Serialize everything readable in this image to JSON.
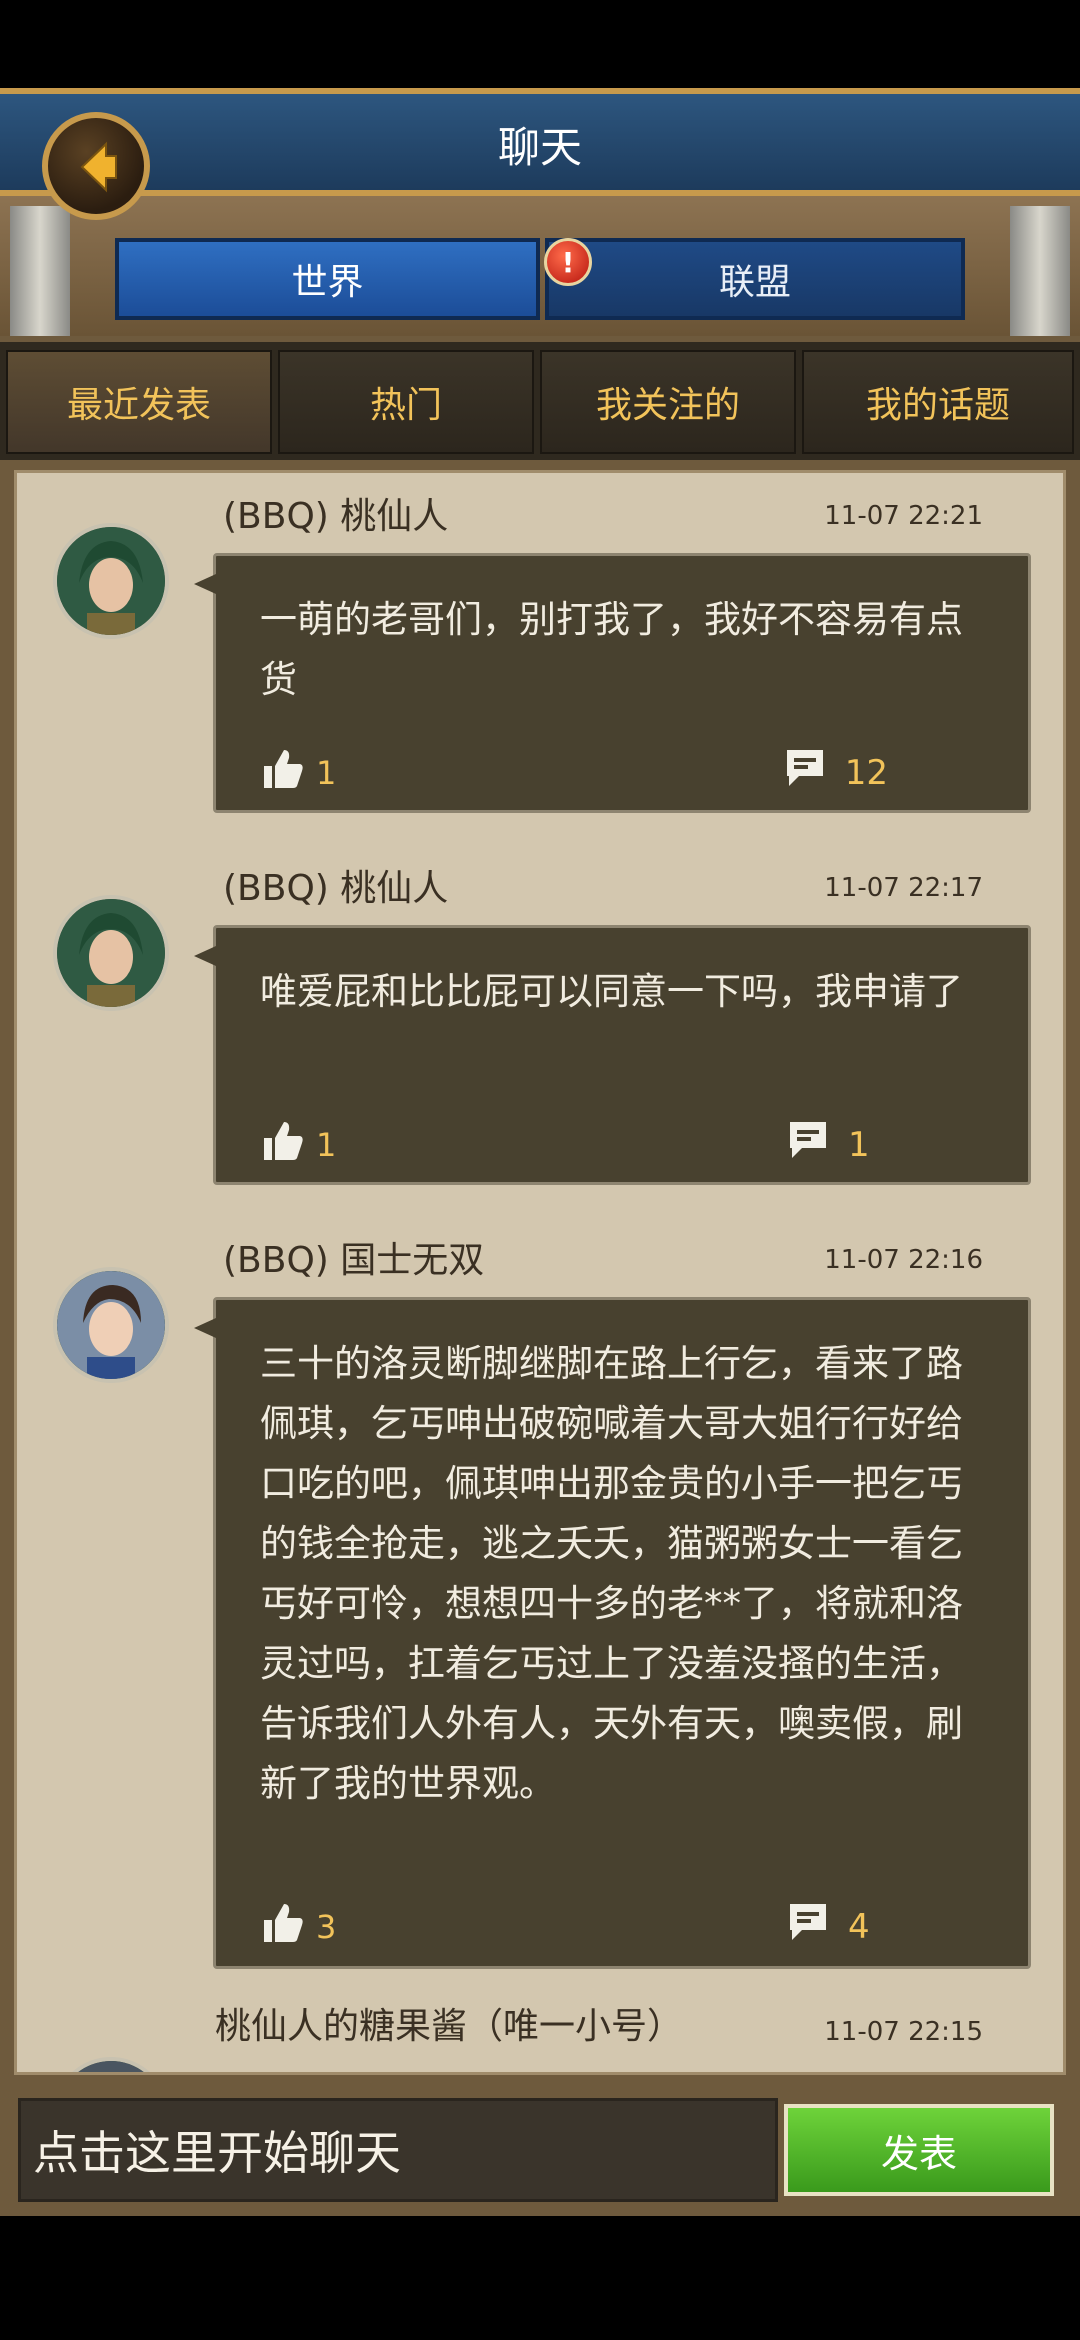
{
  "header": {
    "title": "聊天"
  },
  "channels": [
    {
      "label": "世界",
      "active": true
    },
    {
      "label": "联盟",
      "active": false
    }
  ],
  "channel_badge": "!",
  "subtabs": [
    {
      "label": "最近发表",
      "active": true
    },
    {
      "label": "热门",
      "active": false
    },
    {
      "label": "我关注的",
      "active": false
    },
    {
      "label": "我的话题",
      "active": false
    }
  ],
  "posts": [
    {
      "author": "(BBQ) 桃仙人",
      "time": "11-07 22:21",
      "text": "一萌的老哥们，别打我了，我好不容易有点货",
      "likes": "1",
      "comments": "12"
    },
    {
      "author": "(BBQ) 桃仙人",
      "time": "11-07 22:17",
      "text": "唯爱屁和比比屁可以同意一下吗，我申请了",
      "likes": "1",
      "comments": "1"
    },
    {
      "author": "(BBQ) 国士无双",
      "time": "11-07 22:16",
      "text": "三十的洛灵断脚继脚在路上行乞，看来了路佩琪，乞丐呻出破碗喊着大哥大姐行行好给口吃的吧，佩琪呻出那金贵的小手一把乞丐的钱全抢走，逃之夭夭，猫粥粥女士一看乞丐好可怜，想想四十多的老**了，将就和洛灵过吗，扛着乞丐过上了没羞没搔的生活，告诉我们人外有人，天外有天，噢卖假，刷新了我的世界观。",
      "likes": "3",
      "comments": "4"
    },
    {
      "author": "桃仙人的糖果酱（唯一小号）",
      "time": "11-07 22:15"
    }
  ],
  "composer": {
    "placeholder": "点击这里开始聊天",
    "send_label": "发表"
  },
  "colors": {
    "tab_active": "#2f6fc2",
    "send": "#4fb52a",
    "accent_text": "#f2c35a"
  }
}
